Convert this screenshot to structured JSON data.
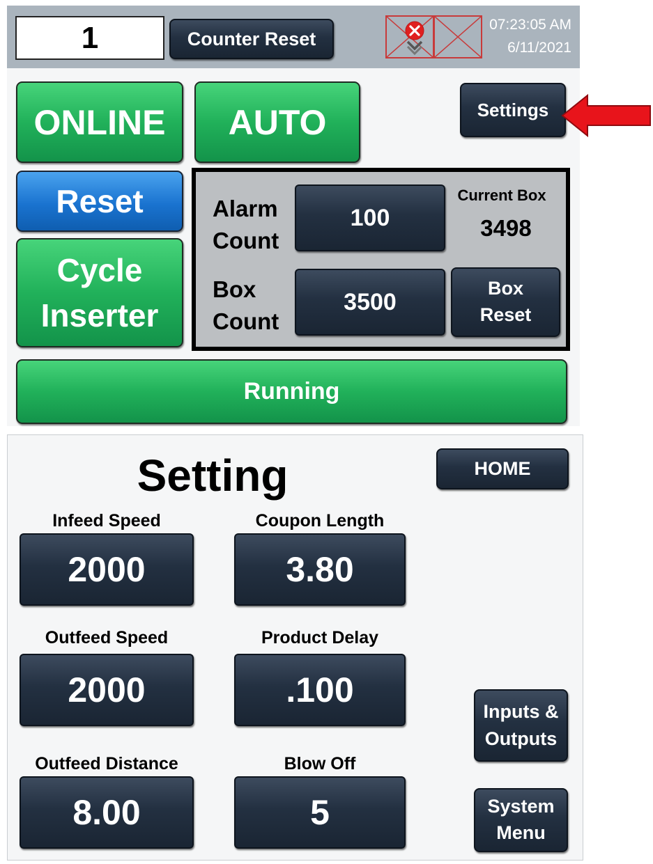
{
  "header": {
    "counter_value": "1",
    "counter_reset_label": "Counter Reset",
    "time": "07:23:05 AM",
    "date": "6/11/2021",
    "alarm_icon": "error-x-circle-icon",
    "icon_colors": {
      "alarm_red": "#e02020",
      "frame_red": "#c83a3a"
    }
  },
  "main": {
    "online_label": "ONLINE",
    "auto_label": "AUTO",
    "settings_label": "Settings",
    "reset_label": "Reset",
    "cycle_inserter_label": [
      "Cycle",
      "Inserter"
    ],
    "status_label": "Running"
  },
  "box_panel": {
    "alarm_count_label": [
      "Alarm",
      "Count"
    ],
    "alarm_count_value": "100",
    "box_count_label": [
      "Box",
      "Count"
    ],
    "box_count_value": "3500",
    "current_box_label": "Current Box",
    "current_box_value": "3498",
    "box_reset_label": [
      "Box",
      "Reset"
    ]
  },
  "settings_screen": {
    "title": "Setting",
    "home_label": "HOME",
    "fields": {
      "infeed_speed": {
        "label": "Infeed Speed",
        "value": "2000"
      },
      "coupon_length": {
        "label": "Coupon Length",
        "value": "3.80"
      },
      "outfeed_speed": {
        "label": "Outfeed Speed",
        "value": "2000"
      },
      "product_delay": {
        "label": "Product Delay",
        "value": ".100"
      },
      "outfeed_distance": {
        "label": "Outfeed Distance",
        "value": "8.00"
      },
      "blow_off": {
        "label": "Blow Off",
        "value": "5"
      }
    },
    "inputs_outputs_label": [
      "Inputs &",
      "Outputs"
    ],
    "system_menu_label": [
      "System",
      "Menu"
    ]
  },
  "theme": {
    "green": "#21b15a",
    "blue": "#1a73d0",
    "navy": "#233041",
    "header_gray": "#aab4bd",
    "arrow_red": "#e8141b",
    "panel_gray": "#bcbfc2"
  }
}
